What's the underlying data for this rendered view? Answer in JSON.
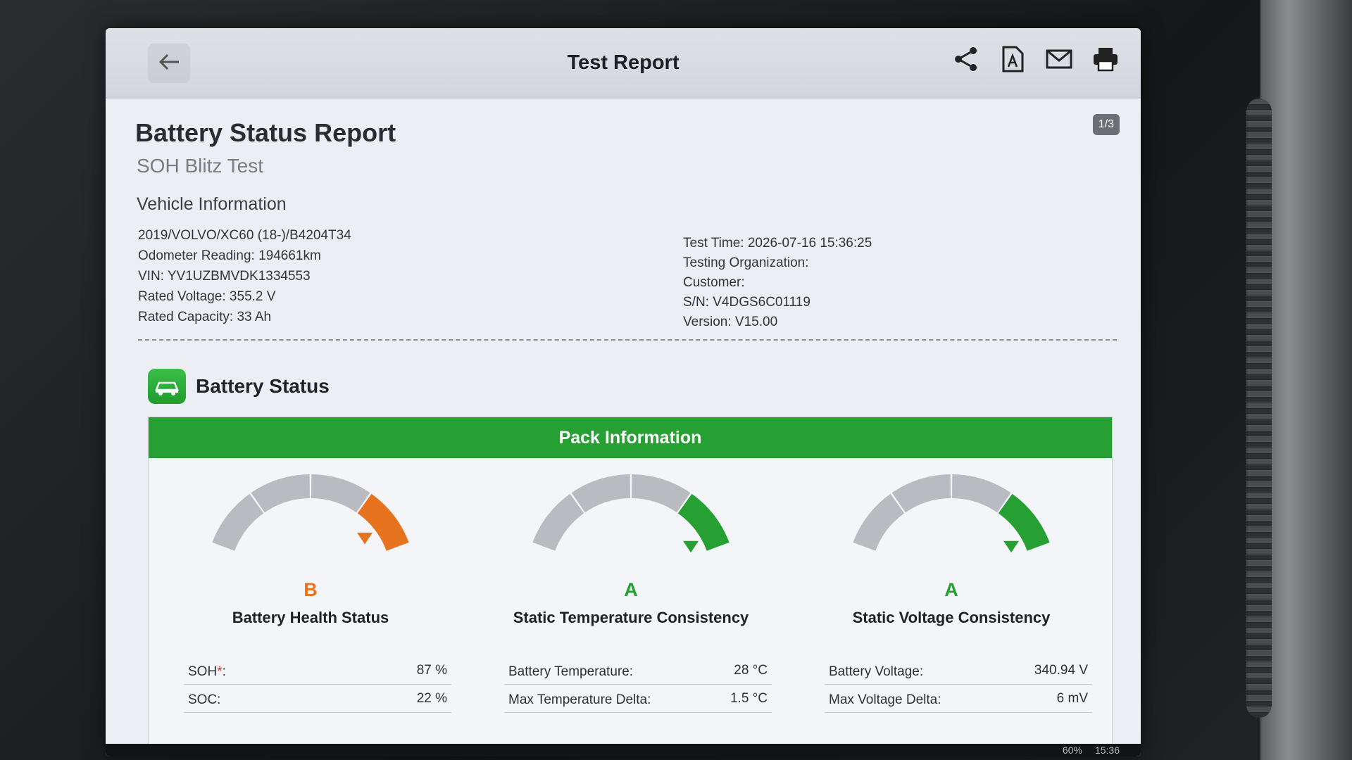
{
  "topbar": {
    "title": "Test Report",
    "icons": [
      "back-icon",
      "share-icon",
      "pdf-icon",
      "mail-icon",
      "print-icon"
    ]
  },
  "page_indicator": "1/3",
  "report": {
    "title": "Battery Status Report",
    "subtitle": "SOH Blitz Test"
  },
  "vehicle_info": {
    "heading": "Vehicle Information",
    "left": [
      "2019/VOLVO/XC60 (18-)/B4204T34",
      "Odometer Reading: 194661km",
      "VIN: YV1UZBMVDK1334553",
      "Rated Voltage: 355.2 V",
      "Rated Capacity: 33 Ah"
    ],
    "right": [
      "Test Time: 2026-07-16 15:36:25",
      "Testing Organization:",
      "Customer:",
      "S/N: V4DGS6C01119",
      "Version: V15.00"
    ]
  },
  "battery_status": {
    "heading": "Battery Status",
    "pack_title": "Pack Information",
    "gauges": [
      {
        "grade": "B",
        "label": "Battery Health Status",
        "grade_color": "#e8731e",
        "level": 0.87,
        "metrics": [
          {
            "label": "SOH",
            "asterisk": "*",
            "suffix": ":",
            "value": "87 %"
          },
          {
            "label": "SOC:",
            "asterisk": "",
            "suffix": "",
            "value": "22 %"
          }
        ]
      },
      {
        "grade": "A",
        "label": "Static Temperature Consistency",
        "grade_color": "#27a033",
        "level": 0.93,
        "metrics": [
          {
            "label": "Battery Temperature:",
            "asterisk": "",
            "suffix": "",
            "value": "28 °C"
          },
          {
            "label": "Max Temperature Delta:",
            "asterisk": "",
            "suffix": "",
            "value": "1.5 °C"
          }
        ]
      },
      {
        "grade": "A",
        "label": "Static Voltage Consistency",
        "grade_color": "#27a033",
        "level": 0.93,
        "metrics": [
          {
            "label": "Battery Voltage:",
            "asterisk": "",
            "suffix": "",
            "value": "340.94 V"
          },
          {
            "label": "Max Voltage Delta:",
            "asterisk": "",
            "suffix": "",
            "value": "6 mV"
          }
        ]
      }
    ]
  },
  "statusbar": {
    "battery": "60%",
    "time": "15:36"
  },
  "colors": {
    "green": "#27a033",
    "orange": "#e8731e",
    "gauge_gray": "#b9bbc0"
  }
}
